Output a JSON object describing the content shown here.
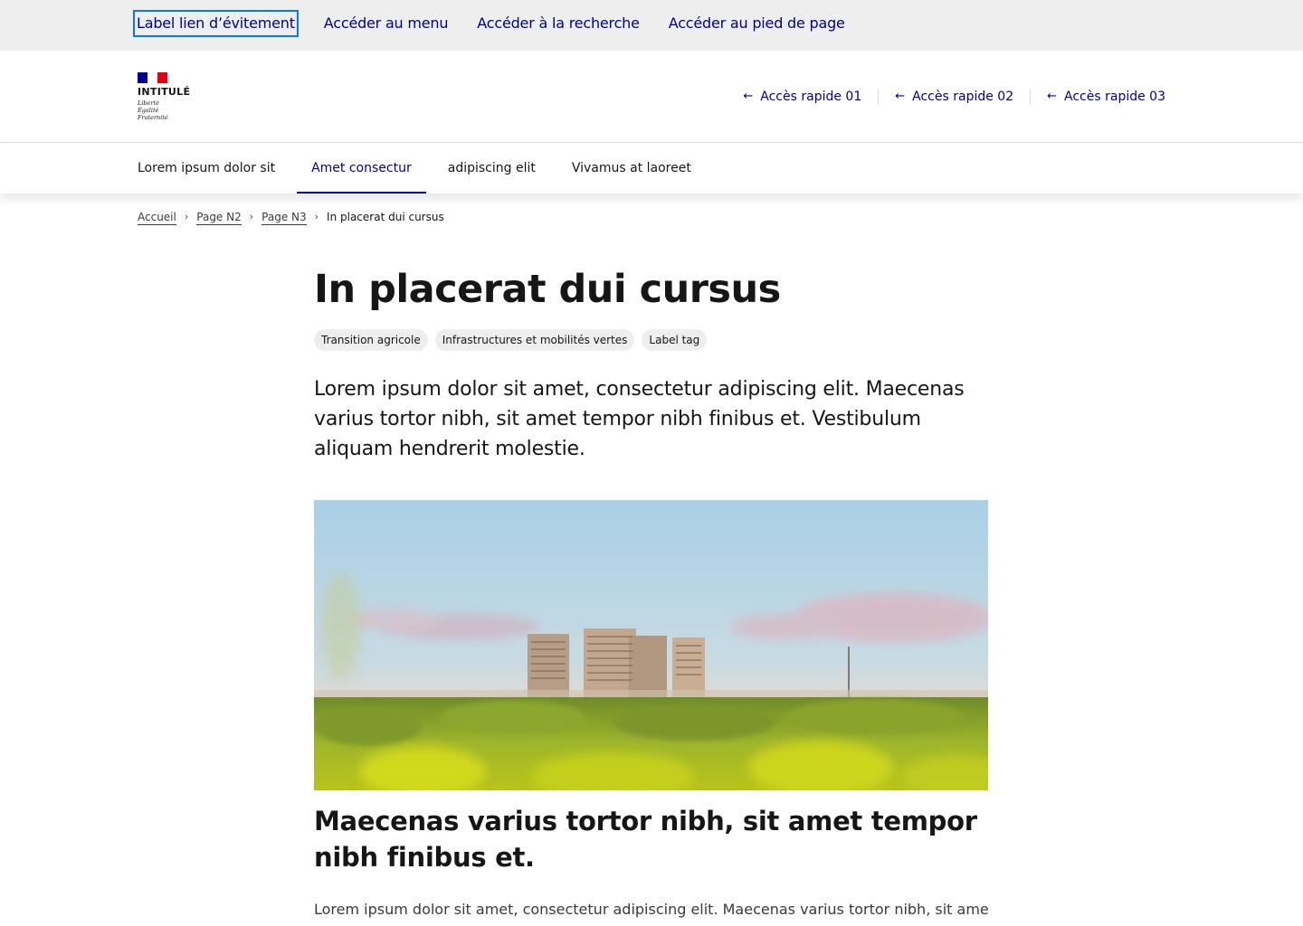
{
  "skip_links": [
    {
      "label": "Label lien d’évitement"
    },
    {
      "label": "Accéder au menu"
    },
    {
      "label": "Accéder à la recherche"
    },
    {
      "label": "Accéder au pied de page"
    }
  ],
  "header": {
    "logo_title": "INTITULÉ",
    "motto": [
      "Liberté",
      "Égalité",
      "Fraternité"
    ],
    "quick_links": [
      {
        "label": "Accès rapide 01",
        "icon": "arrow-left-icon"
      },
      {
        "label": "Accès rapide 02",
        "icon": "arrow-left-icon"
      },
      {
        "label": "Accès rapide 03",
        "icon": "arrow-left-icon"
      }
    ]
  },
  "nav": {
    "items": [
      {
        "label": "Lorem ipsum dolor sit"
      },
      {
        "label": "Amet consectur",
        "active": true
      },
      {
        "label": "adipiscing elit"
      },
      {
        "label": "Vivamus at laoreet"
      }
    ]
  },
  "breadcrumb": {
    "items": [
      "Accueil",
      "Page N2",
      "Page N3"
    ],
    "current": "In placerat dui cursus"
  },
  "article": {
    "title": "In placerat dui cursus",
    "tags": [
      "Transition agricole",
      "Infrastructures et mobilités vertes",
      "Label tag"
    ],
    "lead": "Lorem ipsum dolor sit amet, consectetur adipiscing elit. Maecenas varius tortor nibh, sit amet tempor nibh finibus et. Vestibulum aliquam hendrerit molestie.",
    "subheading": "Maecenas varius tortor nibh, sit amet tempor nibh finibus et.",
    "body": "Lorem ipsum dolor sit amet, consectetur adipiscing elit. Maecenas varius tortor nibh, sit amet"
  },
  "colors": {
    "primary": "#000091",
    "focus": "#0a76f6",
    "marianne_red": "#e1000f"
  }
}
